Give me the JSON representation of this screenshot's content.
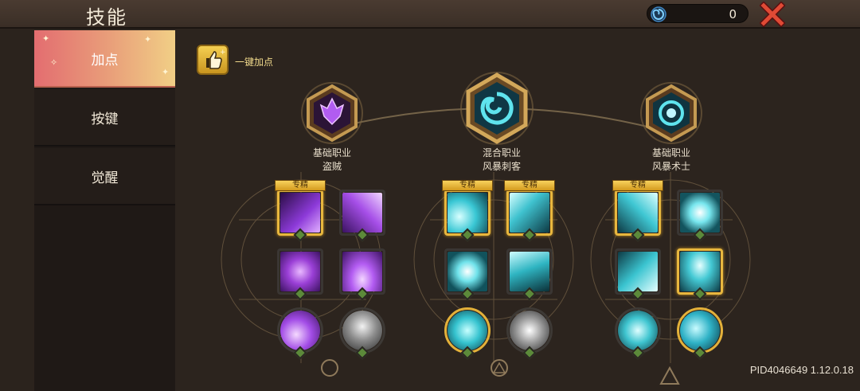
{
  "header": {
    "title": "技能",
    "currency_value": "0",
    "currency_icon": "swirl-gem-icon",
    "close_icon": "close-x-icon"
  },
  "sidebar": {
    "tabs": [
      {
        "label": "加点",
        "active": true
      },
      {
        "label": "按键",
        "active": false
      },
      {
        "label": "觉醒",
        "active": false
      }
    ]
  },
  "main": {
    "auto_allocate_label": "一键加点",
    "auto_allocate_icon": "thumbs-up-icon",
    "specialty_badge": "专精",
    "classes": [
      {
        "line1": "基础职业",
        "line2": "盗贼",
        "icon": "purple-flame-crest-icon"
      },
      {
        "line1": "混合职业",
        "line2": "风暴刺客",
        "icon": "storm-vortex-icon"
      },
      {
        "line1": "基础职业",
        "line2": "风暴术士",
        "icon": "storm-orb-icon"
      }
    ],
    "pid": "PID4046649 1.12.0.18"
  },
  "colors": {
    "accent_gold": "#e8b73e",
    "tab_active": "#e9a07a",
    "rogue_purple": "#9a3fd6",
    "storm_cyan": "#39c7d4"
  }
}
